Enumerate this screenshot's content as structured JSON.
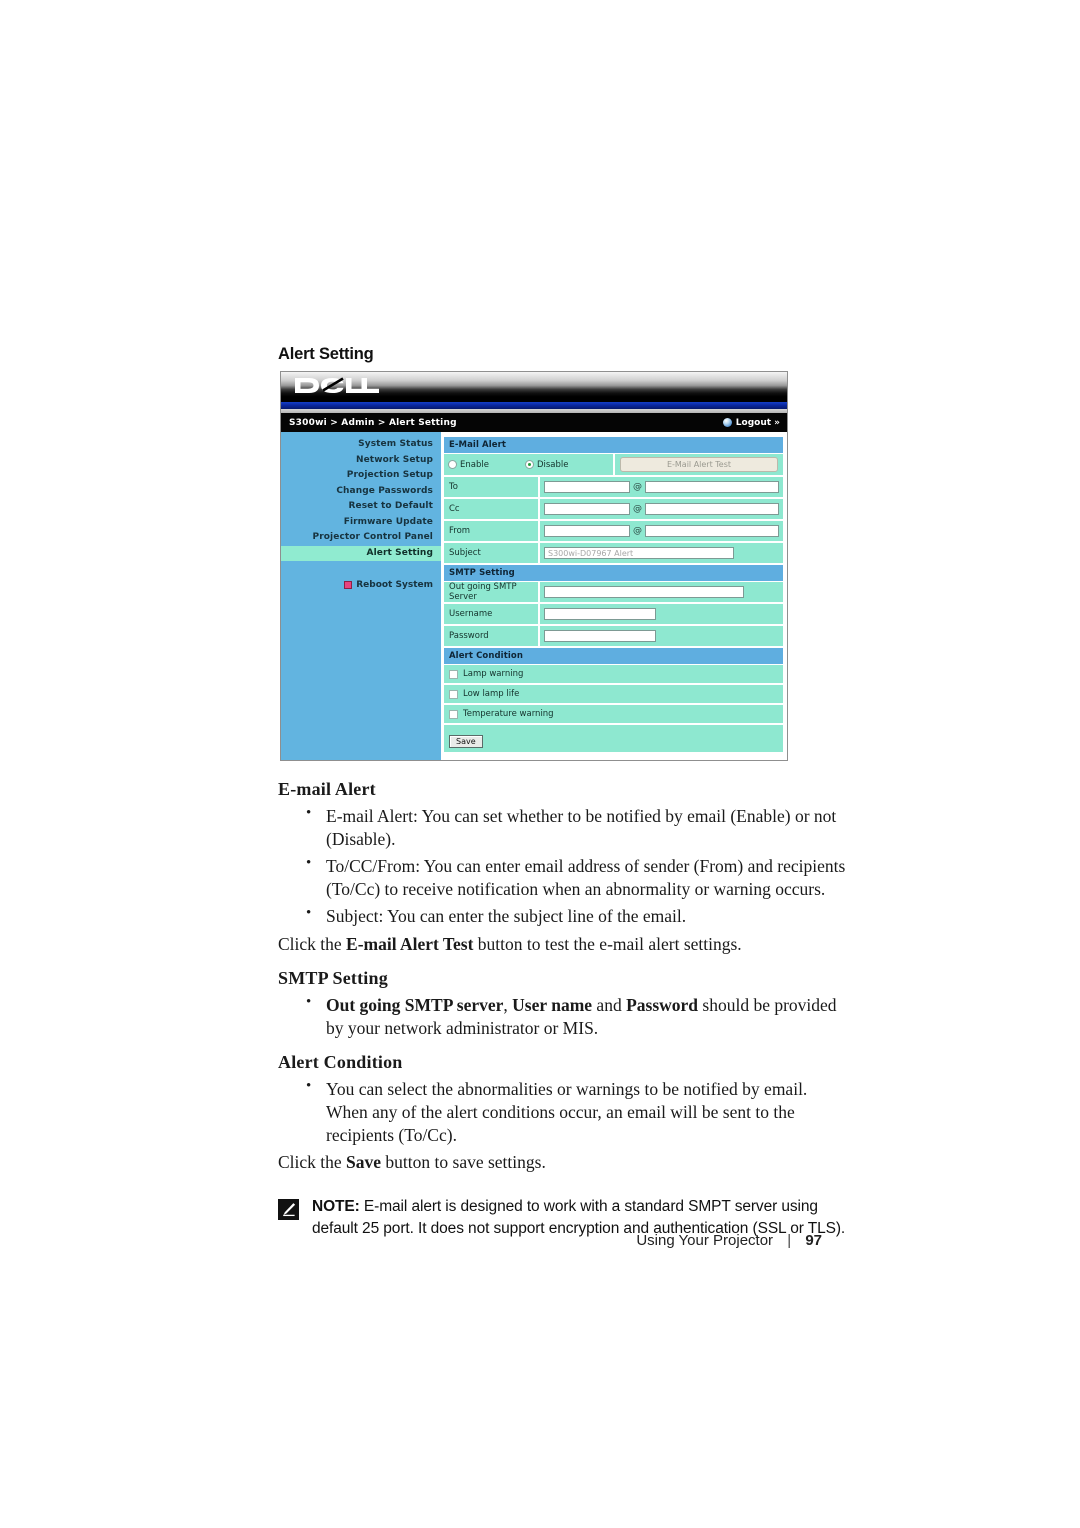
{
  "page": {
    "heading": "Alert Setting",
    "footer_label": "Using Your Projector",
    "footer_separator": "|",
    "footer_page": "97"
  },
  "ui": {
    "brand": "DELL",
    "breadcrumb": "S300wi > Admin > Alert Setting",
    "logout_label": "Logout »",
    "sidebar": {
      "items": [
        {
          "label": "System Status",
          "active": false
        },
        {
          "label": "Network Setup",
          "active": false
        },
        {
          "label": "Projection Setup",
          "active": false
        },
        {
          "label": "Change Passwords",
          "active": false
        },
        {
          "label": "Reset to Default",
          "active": false
        },
        {
          "label": "Firmware Update",
          "active": false
        },
        {
          "label": "Projector Control Panel",
          "active": false
        },
        {
          "label": "Alert Setting",
          "active": true
        }
      ],
      "reboot_label": "Reboot System"
    },
    "email_alert": {
      "section_title": "E-Mail Alert",
      "enable_label": "Enable",
      "disable_label": "Disable",
      "enable_selected": false,
      "disable_selected": true,
      "test_button_label": "E-Mail Alert Test",
      "test_button_disabled": true,
      "at_symbol": "@",
      "rows": [
        {
          "label": "To",
          "user": "",
          "domain": ""
        },
        {
          "label": "Cc",
          "user": "",
          "domain": ""
        },
        {
          "label": "From",
          "user": "",
          "domain": ""
        }
      ],
      "subject_label": "Subject",
      "subject_value": "S300wi-D07967 Alert"
    },
    "smtp_setting": {
      "section_title": "SMTP Setting",
      "rows": [
        {
          "label": "Out going SMTP Server",
          "value": "",
          "size": "lg"
        },
        {
          "label": "Username",
          "value": "",
          "size": "md"
        },
        {
          "label": "Password",
          "value": "",
          "size": "md"
        }
      ]
    },
    "alert_condition": {
      "section_title": "Alert Condition",
      "conditions": [
        {
          "label": "Lamp warning",
          "checked": false
        },
        {
          "label": "Low lamp life",
          "checked": false
        },
        {
          "label": "Temperature warning",
          "checked": false
        }
      ],
      "save_label": "Save"
    }
  },
  "doc": {
    "email_alert": {
      "heading": "E-mail Alert",
      "bullets": [
        "E-mail Alert: You can set whether to be notified by email (Enable) or not (Disable).",
        "To/CC/From: You can enter email address of sender (From) and recipients (To/Cc) to receive notification when an abnormality or warning occurs.",
        "Subject: You can enter the subject line of the email."
      ],
      "para_pre": "Click the ",
      "para_bold": "E-mail Alert Test",
      "para_post": " button to test the e-mail alert settings."
    },
    "smtp_setting": {
      "heading": "SMTP Setting",
      "bullet_bold_1": "Out going SMTP server",
      "bullet_mid_1": ", ",
      "bullet_bold_2": "User name",
      "bullet_mid_2": " and ",
      "bullet_bold_3": "Password",
      "bullet_tail": " should be provided by your network administrator or MIS."
    },
    "alert_condition": {
      "heading": "Alert Condition",
      "bullet": "You can select the abnormalities or warnings to be notified by email. When any of the alert conditions occur, an email will be sent to the recipients (To/Cc).",
      "para_pre": "Click the ",
      "para_bold": "Save",
      "para_post": " button to save settings."
    },
    "note": {
      "label": "NOTE:",
      "text": " E-mail alert is designed to work with a standard SMPT server using default 25 port. It does not support encryption and authentication (SSL or TLS)."
    }
  },
  "colors": {
    "sidebar_blue": "#62b4e0",
    "active_mint": "#90ebd0",
    "row_mint": "#8ee8d0",
    "section_header_blue": "#5faee0",
    "banner_black": "#000000",
    "banner_blue": "#0b28a0"
  }
}
